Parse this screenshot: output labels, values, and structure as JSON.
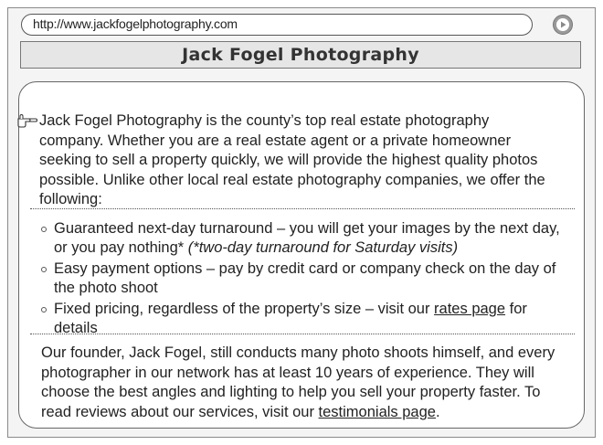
{
  "browser": {
    "url": "http://www.jackfogelphotography.com",
    "go_icon": "play-arrow-icon"
  },
  "page": {
    "title": "Jack Fogel Photography",
    "intro": {
      "icon": "pointing-hand-icon",
      "text": "Jack Fogel Photography is the county’s top real estate photography company. Whether you are a real estate agent or a private homeowner seeking to sell a property quickly, we will provide the highest quality photos possible. Unlike other local real estate photography companies, we offer the following:"
    },
    "bullets": [
      {
        "text": "Guaranteed next-day turnaround – you will get your images by the next day, or you pay nothing* ",
        "italic": "(*two-day turnaround for Saturday visits)"
      },
      {
        "text": "Easy payment options – pay by credit card or company check on the day of the photo shoot"
      },
      {
        "text_before": "Fixed pricing, regardless of the property’s size – visit our ",
        "link": "rates page",
        "text_after": " for details"
      }
    ],
    "founder": {
      "text_before": "Our founder, Jack Fogel, still conducts many photo shoots himself, and every photographer in our network has at least 10 years of experience. They will choose the best angles and lighting to help you sell your property faster. To read reviews about our services, visit our ",
      "link": "testimonials page",
      "text_after": "."
    }
  }
}
